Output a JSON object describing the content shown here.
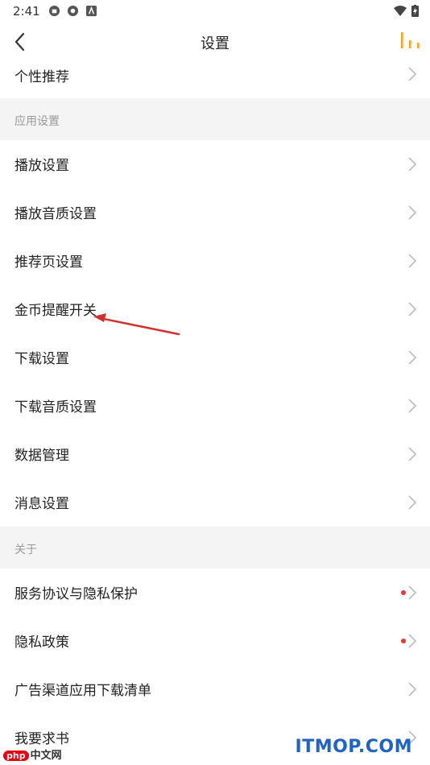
{
  "status_bar": {
    "time": "2:41"
  },
  "nav": {
    "title": "设置"
  },
  "rows_top": [
    {
      "label": "个性推荐"
    }
  ],
  "sections": [
    {
      "title": "应用设置",
      "items": [
        {
          "label": "播放设置"
        },
        {
          "label": "播放音质设置"
        },
        {
          "label": "推荐页设置"
        },
        {
          "label": "金币提醒开关"
        },
        {
          "label": "下载设置"
        },
        {
          "label": "下载音质设置"
        },
        {
          "label": "数据管理"
        },
        {
          "label": "消息设置"
        }
      ]
    },
    {
      "title": "关于",
      "items": [
        {
          "label": "服务协议与隐私保护",
          "dot": true
        },
        {
          "label": "隐私政策",
          "dot": true
        },
        {
          "label": "广告渠道应用下载清单"
        },
        {
          "label": "我要求书"
        }
      ]
    }
  ],
  "watermarks": {
    "left_badge": "php",
    "left_text": "中文网",
    "right_text": "ITMOP.COM"
  },
  "colors": {
    "accent": "#f5a623",
    "annotation_arrow": "#d32f2f",
    "dot": "#e53935",
    "section_bg": "#f4f4f4"
  }
}
